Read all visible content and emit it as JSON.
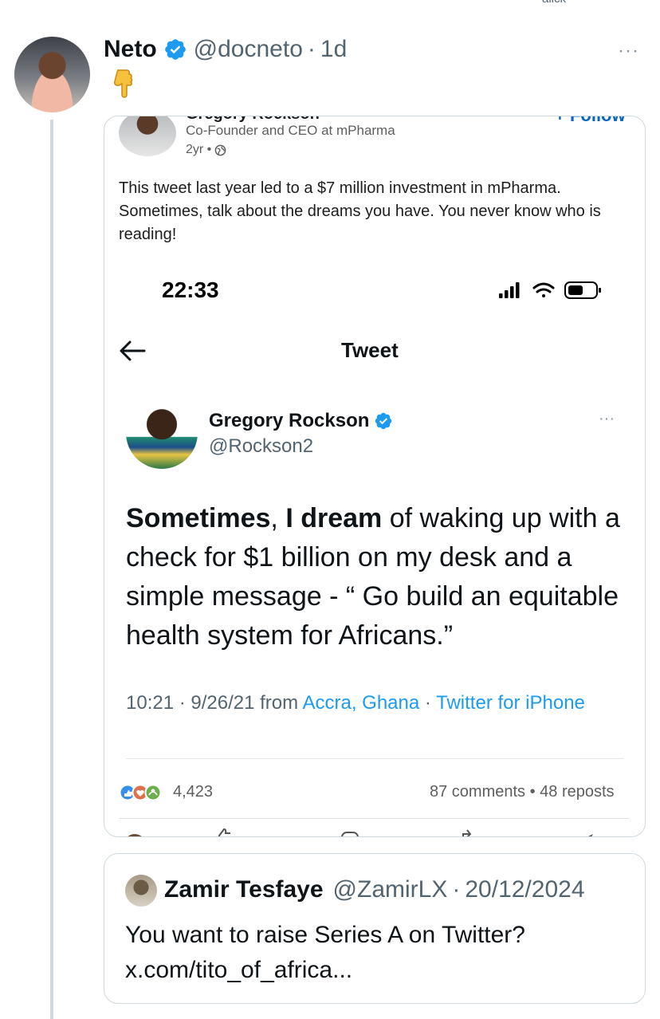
{
  "top_cut_text": "alick",
  "post": {
    "author_name": "Neto",
    "author_handle": "@docneto",
    "separator": "·",
    "time": "1d",
    "more": "···",
    "emoji": "👇"
  },
  "linkedin": {
    "name": "Gregory Rockson",
    "follow_label": "+ Follow",
    "subtitle": "Co-Founder and CEO at mPharma",
    "age": "2yr •",
    "text": "This tweet last year led to a $7 million investment in mPharma. Sometimes, talk about the dreams you have. You never know who is reading!",
    "reactions_count": "4,423",
    "comments_reposts": "87 comments • 48 reposts"
  },
  "phone_screenshot": {
    "status_time": "22:33",
    "title": "Tweet",
    "name": "Gregory Rockson",
    "handle": "@Rockson2",
    "more": "···",
    "text_bold_1": "Sometimes",
    "text_part_1": ", ",
    "text_bold_2": "I dream",
    "text_rest": " of waking up with a check for $1 billion on my desk and a simple message - “ Go build an equitable health system for Africans.”",
    "meta_time": "10:21 · 9/26/21 from ",
    "meta_location": "Accra, Ghana",
    "meta_sep": " · ",
    "meta_client": "Twitter for iPhone"
  },
  "quote": {
    "name": "Zamir Tesfaye",
    "handle": "@ZamirLX",
    "separator": "·",
    "date": "20/12/2024",
    "text_line1": "You want to raise Series A on Twitter?",
    "text_line2": "x.com/tito_of_africa..."
  },
  "colors": {
    "verified": "#1d9bf0",
    "link": "#1d9bf0",
    "muted": "#536471",
    "border": "#cfd9de"
  }
}
